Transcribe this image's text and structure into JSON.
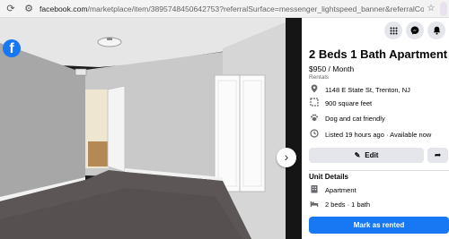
{
  "browser": {
    "back_icon": "back-icon",
    "reload_icon": "reload-icon",
    "url_host": "facebook.com",
    "url_path": "/marketplace/item/3895748450642753?referralSurface=messenger_lightspeed_banner&referralCode=messenger_banner"
  },
  "viewer": {
    "logo_letter": "f",
    "next_glyph": "›"
  },
  "listing": {
    "title": "2 Beds 1 Bath Apartment",
    "price": "$950 / Month",
    "category": "Rentals",
    "address": "1148 E State St, Trenton, NJ",
    "size": "900 square feet",
    "pets": "Dog and cat friendly",
    "listed": "Listed 19 hours ago · Available now",
    "edit_label": "Edit",
    "unit_details_heading": "Unit Details",
    "unit_type": "Apartment",
    "beds_baths": "2 beds · 1 bath",
    "mark_label": "Mark as rented"
  },
  "colors": {
    "brand": "#1877f2",
    "button_gray": "#e4e6eb",
    "secondary_text": "#65676b"
  }
}
